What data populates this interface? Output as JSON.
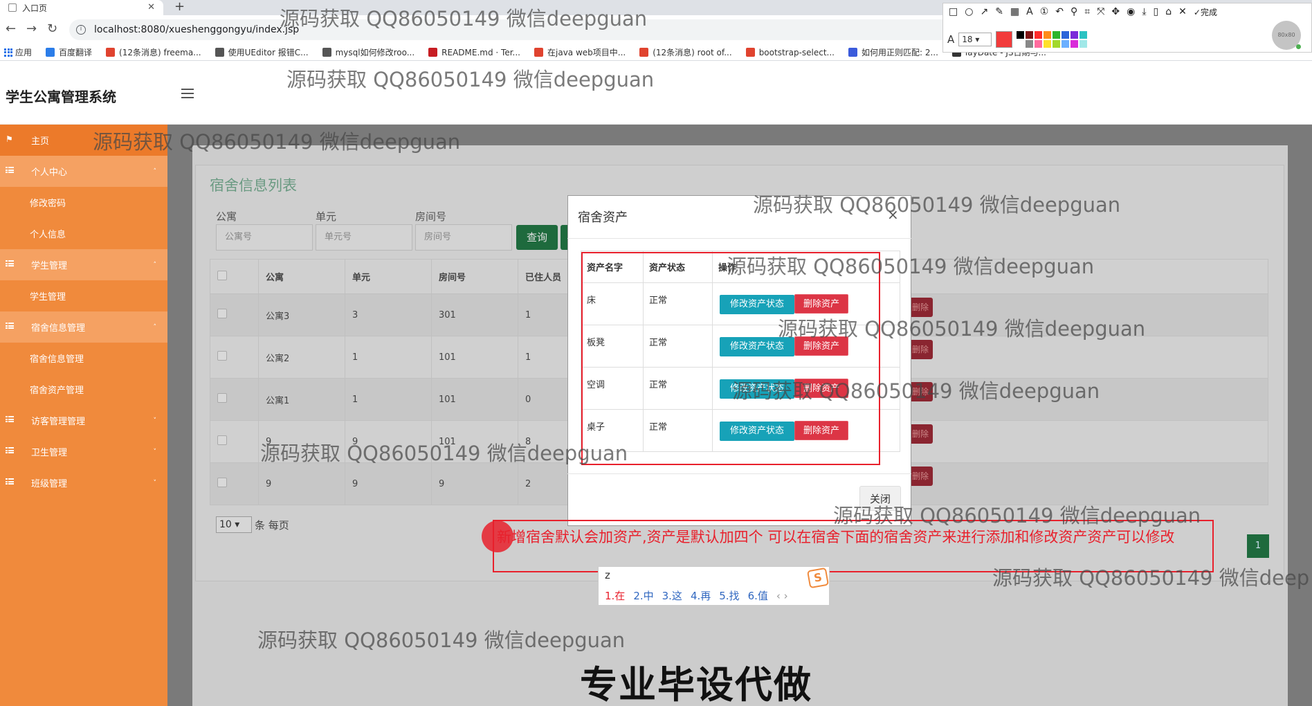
{
  "browser": {
    "tab_title": "入口页",
    "url": "localhost:8080/xueshenggongyu/index.jsp",
    "bookmarks": [
      {
        "label": "应用",
        "color": "#1a73e8"
      },
      {
        "label": "百度翻译",
        "color": "#2b7de9"
      },
      {
        "label": "(12条消息) freema...",
        "color": "#e0432f"
      },
      {
        "label": "使用UEditor 报错C...",
        "color": "#555555"
      },
      {
        "label": "mysql如何修改roo...",
        "color": "#555555"
      },
      {
        "label": "README.md · Ter...",
        "color": "#c71d23"
      },
      {
        "label": "在java web项目中...",
        "color": "#e0432f"
      },
      {
        "label": "(12条消息) root of...",
        "color": "#e0432f"
      },
      {
        "label": "bootstrap-select...",
        "color": "#e0432f"
      },
      {
        "label": "如何用正则匹配: 2...",
        "color": "#3b5bdb"
      },
      {
        "label": "layDate - JS日期与...",
        "color": "#333333"
      }
    ]
  },
  "snip_tool": {
    "font_size": "18",
    "done_label": "完成",
    "active_color": "#f23b3b",
    "palette": [
      "#000000",
      "#7f1313",
      "#ff2b2b",
      "#ff8c1a",
      "#2db52d",
      "#2b65d9",
      "#7a2bd9",
      "#2bc2c2",
      "#ffffff",
      "#888888",
      "#ff6b9e",
      "#ffe02b",
      "#a2d92b",
      "#6bb0ff",
      "#d92bd9",
      "#a0e8e8"
    ]
  },
  "app": {
    "title": "学生公寓管理系统",
    "avatar_text": "80x80"
  },
  "sidebar": {
    "items": [
      {
        "label": "主页",
        "type": "home"
      },
      {
        "label": "个人中心",
        "type": "parent",
        "caret": "˄"
      },
      {
        "label": "修改密码",
        "type": "sub"
      },
      {
        "label": "个人信息",
        "type": "sub"
      },
      {
        "label": "学生管理",
        "type": "parent",
        "caret": "˄"
      },
      {
        "label": "学生管理",
        "type": "sub"
      },
      {
        "label": "宿舍信息管理",
        "type": "parent",
        "caret": "˄"
      },
      {
        "label": "宿舍信息管理",
        "type": "sub"
      },
      {
        "label": "宿舍资产管理",
        "type": "sub"
      },
      {
        "label": "访客管理管理",
        "type": "parent-closed",
        "caret": "˅"
      },
      {
        "label": "卫生管理",
        "type": "parent-closed",
        "caret": "˅"
      },
      {
        "label": "班级管理",
        "type": "parent-closed",
        "caret": "˅"
      }
    ]
  },
  "main": {
    "panel_title": "宿舍信息列表",
    "filters": [
      {
        "label": "公寓",
        "placeholder": "公寓号"
      },
      {
        "label": "单元",
        "placeholder": "单元号"
      },
      {
        "label": "房间号",
        "placeholder": "房间号"
      }
    ],
    "query_label": "查询",
    "columns": [
      "公寓",
      "单元",
      "房间号",
      "已住人员"
    ],
    "rows": [
      [
        "公寓3",
        "3",
        "301",
        "1"
      ],
      [
        "公寓2",
        "1",
        "101",
        "1"
      ],
      [
        "公寓1",
        "1",
        "101",
        "0"
      ],
      [
        "9",
        "9",
        "101",
        "8"
      ],
      [
        "9",
        "9",
        "9",
        "2"
      ]
    ],
    "row_delete_label": "删除",
    "page_size": "10",
    "page_size_suffix": "条 每页",
    "current_page": "1"
  },
  "modal": {
    "title": "宿舍资产",
    "close_icon": "×",
    "columns": [
      "资产名字",
      "资产状态",
      "操作"
    ],
    "rows": [
      {
        "name": "床",
        "status": "正常"
      },
      {
        "name": "板凳",
        "status": "正常"
      },
      {
        "name": "空调",
        "status": "正常"
      },
      {
        "name": "桌子",
        "status": "正常"
      }
    ],
    "edit_label": "修改资产状态",
    "delete_label": "删除资产",
    "close_button": "关闭"
  },
  "annotation": {
    "text": "新增宿舍默认会加资产,资产是默认加四个  可以在宿舍下面的宿舍资产来进行添加和修改资产资产可以修改",
    "accent": "#e8202c"
  },
  "ime": {
    "input": "z",
    "candidates": [
      "1.在",
      "2.中",
      "3.这",
      "4.再",
      "5.找",
      "6.值"
    ],
    "nav": "‹ ›"
  },
  "watermark_text": "源码获取 QQ86050149 微信deepguan",
  "watermark_partial": "源码获取 QQ86050149 微信deep",
  "banner": "专业毕设代做"
}
